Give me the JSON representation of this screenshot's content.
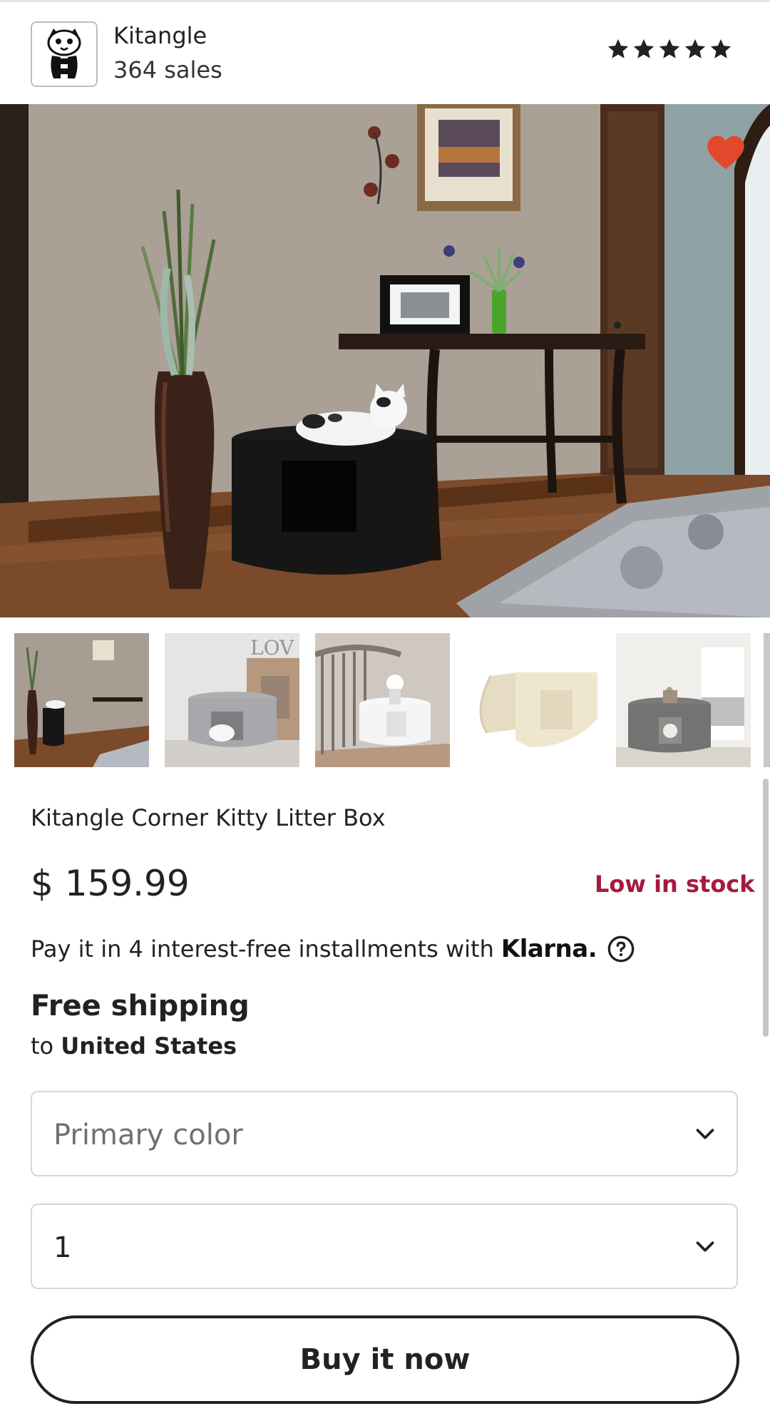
{
  "shop": {
    "name": "Kitangle",
    "sales": "364 sales",
    "rating_stars": 5,
    "logo_icon": "cat-face-logo-icon"
  },
  "gallery": {
    "favorite_icon": "heart-icon",
    "favorite_color": "#e3482d",
    "main_image": "room with black round corner litter box and white cat",
    "thumbnails": [
      "black litter box in hallway with cat",
      "gray litter box with cat exiting",
      "white litter box by staircase",
      "cream litter box with open lid",
      "black litter box in kitchen with cat"
    ]
  },
  "product": {
    "title": "Kitangle Corner Kitty Litter Box",
    "price": "$ 159.99",
    "stock_status": "Low in stock",
    "stock_color": "#a61a3f"
  },
  "payment": {
    "text": "Pay it in 4 interest-free installments with",
    "provider": "Klarna.",
    "help_icon": "question-circle-icon"
  },
  "shipping": {
    "title": "Free shipping",
    "to_prefix": "to",
    "country": "United States"
  },
  "options": {
    "color_select": "Primary color",
    "quantity_select": "1",
    "chevron_icon": "chevron-down-icon"
  },
  "actions": {
    "buy_now": "Buy it now"
  }
}
